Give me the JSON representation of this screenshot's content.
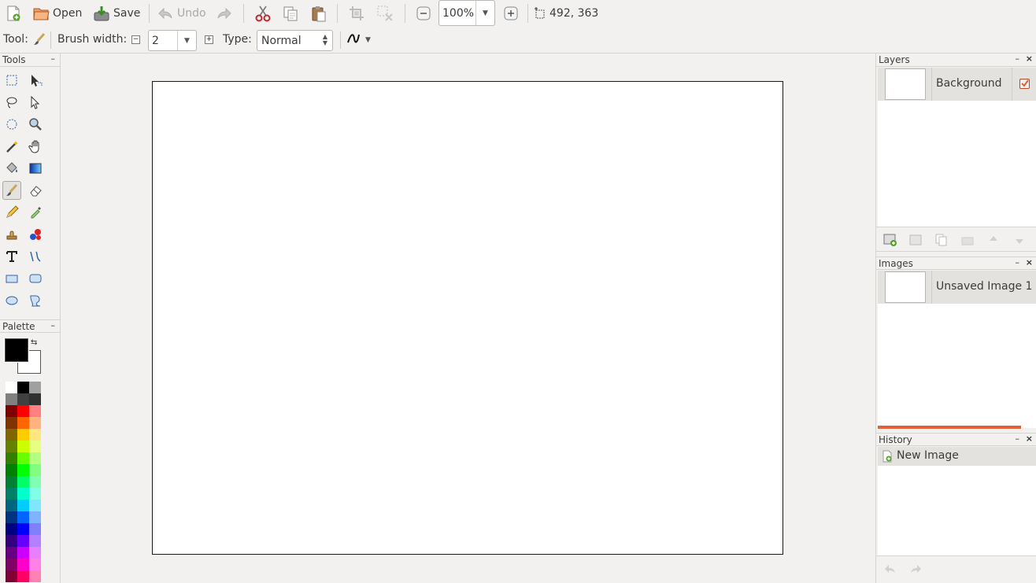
{
  "toolbar": {
    "open_label": "Open",
    "save_label": "Save",
    "undo_label": "Undo",
    "zoom_value": "100%",
    "cursor_position": "492, 363"
  },
  "toolopts": {
    "tool_label": "Tool:",
    "brush_width_label": "Brush width:",
    "brush_width_value": "2",
    "type_label": "Type:",
    "type_value": "Normal"
  },
  "panels": {
    "tools_title": "Tools",
    "palette_title": "Palette",
    "layers_title": "Layers",
    "images_title": "Images",
    "history_title": "History"
  },
  "layers": [
    {
      "name": "Background",
      "visible": true
    }
  ],
  "images": [
    {
      "name": "Unsaved Image 1"
    }
  ],
  "history": [
    {
      "name": "New Image"
    }
  ],
  "palette": {
    "primary": "#000000",
    "secondary": "#ffffff",
    "swatches": [
      [
        "#ffffff",
        "#000000",
        "#a0a0a0"
      ],
      [
        "#808080",
        "#404040",
        "#303030"
      ],
      [
        "#800000",
        "#ff0000",
        "#ff8080"
      ],
      [
        "#803300",
        "#ff6600",
        "#ffb380"
      ],
      [
        "#806600",
        "#ffcc00",
        "#ffe680"
      ],
      [
        "#668000",
        "#ccff00",
        "#e6ff80"
      ],
      [
        "#338000",
        "#66ff00",
        "#b3ff80"
      ],
      [
        "#008000",
        "#00ff00",
        "#80ff80"
      ],
      [
        "#008033",
        "#00ff66",
        "#80ffb3"
      ],
      [
        "#008066",
        "#00ffcc",
        "#80ffe6"
      ],
      [
        "#006680",
        "#00ccff",
        "#80e6ff"
      ],
      [
        "#003380",
        "#0066ff",
        "#80b3ff"
      ],
      [
        "#000080",
        "#0000ff",
        "#8080ff"
      ],
      [
        "#330080",
        "#6600ff",
        "#b380ff"
      ],
      [
        "#660080",
        "#cc00ff",
        "#e680ff"
      ],
      [
        "#800066",
        "#ff00cc",
        "#ff80e6"
      ],
      [
        "#800033",
        "#ff0066",
        "#ff80b3"
      ]
    ]
  },
  "tools": [
    [
      "rectangle-select-icon",
      "move-selected-icon"
    ],
    [
      "lasso-select-icon",
      "move-selection-icon"
    ],
    [
      "ellipse-select-icon",
      "zoom-icon"
    ],
    [
      "magic-wand-icon",
      "pan-icon"
    ],
    [
      "paint-bucket-icon",
      "gradient-icon"
    ],
    [
      "paintbrush-icon",
      "eraser-icon"
    ],
    [
      "pencil-icon",
      "color-picker-icon"
    ],
    [
      "clone-stamp-icon",
      "recolor-icon"
    ],
    [
      "text-icon",
      "line-curve-icon"
    ],
    [
      "rectangle-icon",
      "rounded-rectangle-icon"
    ],
    [
      "ellipse-icon",
      "freeform-shape-icon"
    ]
  ],
  "colors": {
    "accent": "#e0603a",
    "selected_row": "#e4e2df"
  }
}
